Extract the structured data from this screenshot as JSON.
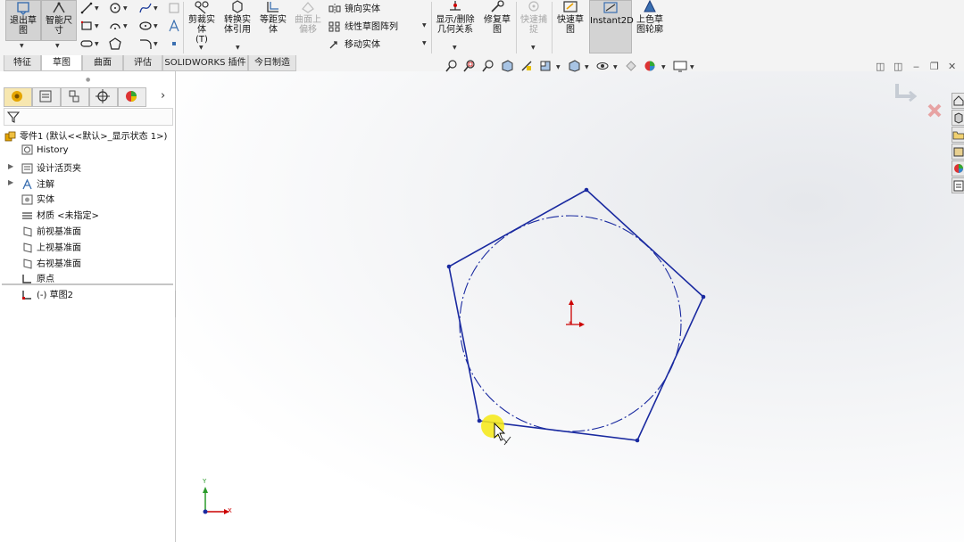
{
  "ribbon": {
    "exit_sketch": "退出草图",
    "smart_dimension": "智能尺寸",
    "trim": "剪裁实体",
    "trim_suffix": "(T)",
    "convert": "转换实体引用",
    "offset": "等距实体",
    "offset_surface": "曲面上偏移",
    "mirror": "镜向实体",
    "linear_pattern": "线性草图阵列",
    "move": "移动实体",
    "relations": "显示/删除几何关系",
    "repair": "修复草图",
    "quick_snap": "快速捕捉",
    "rapid_sketch": "快速草图",
    "instant2d": "Instant2D",
    "shaded_contours": "上色草图轮廓"
  },
  "tabs": [
    {
      "label": "特征"
    },
    {
      "label": "草图"
    },
    {
      "label": "曲面"
    },
    {
      "label": "评估"
    },
    {
      "label": "SOLIDWORKS 插件"
    },
    {
      "label": "今日制造"
    }
  ],
  "tree": {
    "root": "零件1  (默认<<默认>_显示状态 1>)",
    "items": [
      {
        "label": "History"
      },
      {
        "label": "设计活页夹"
      },
      {
        "label": "注解"
      },
      {
        "label": "实体"
      },
      {
        "label": "材质 <未指定>"
      },
      {
        "label": "前视基准面"
      },
      {
        "label": "上视基准面"
      },
      {
        "label": "右视基准面"
      },
      {
        "label": "原点"
      },
      {
        "label": "(-) 草图2"
      }
    ]
  },
  "viewport": {
    "axis_x": "X",
    "axis_y": "Y"
  },
  "colors": {
    "sketch_line": "#1a2aa0",
    "origin": "#cc0000",
    "cursor_highlight": "#f5e81a"
  }
}
